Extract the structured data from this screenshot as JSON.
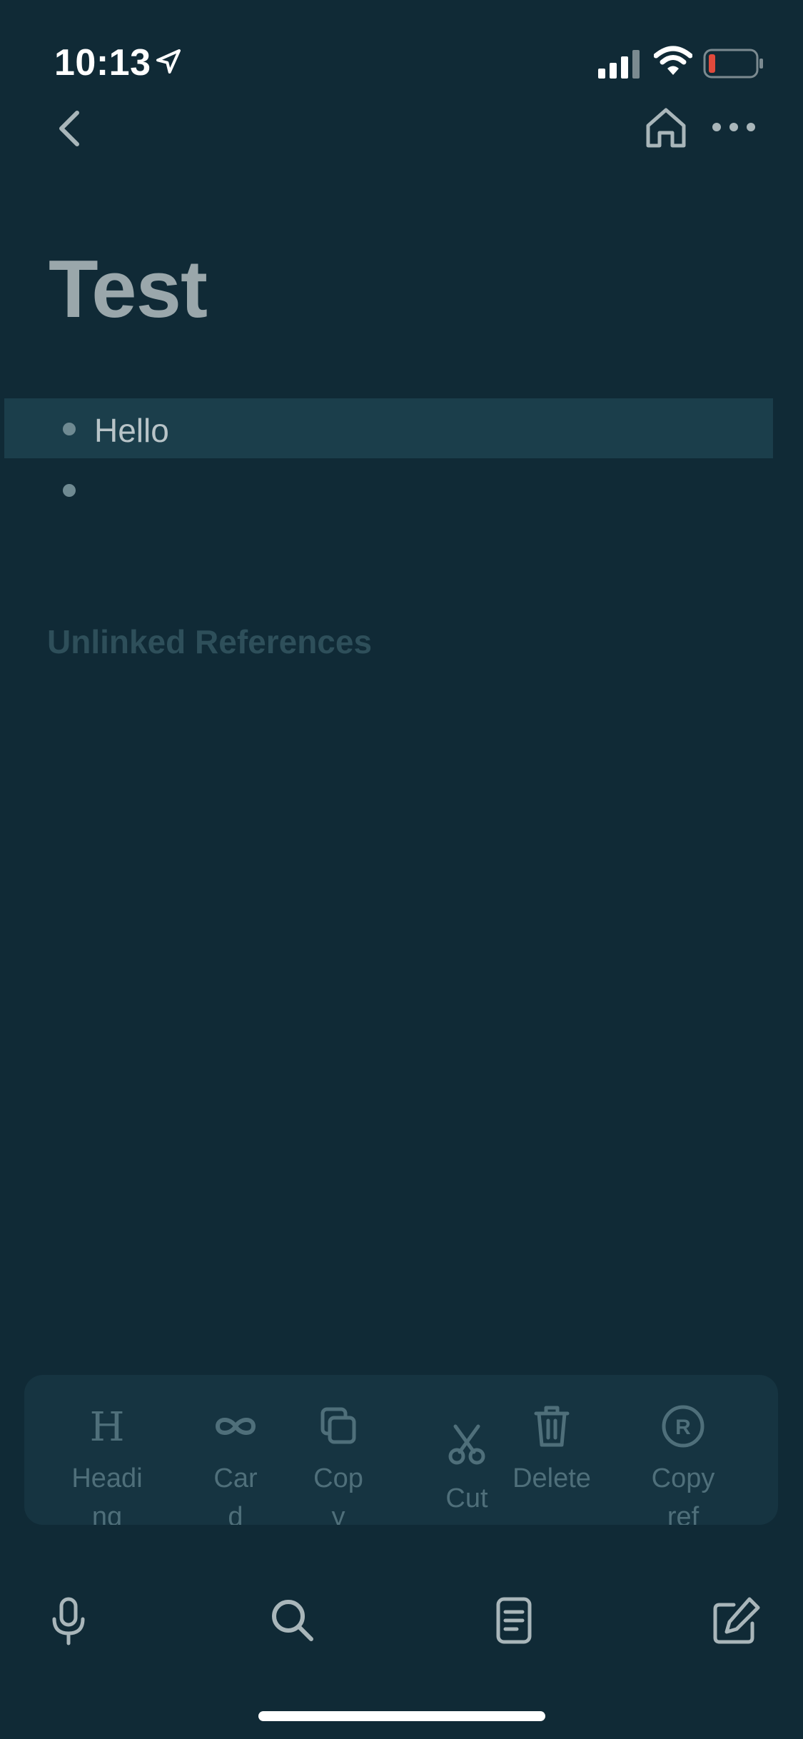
{
  "status_bar": {
    "time": "10:13",
    "battery_level": 0.1,
    "battery_color": "#e04a3c"
  },
  "nav": {
    "back_icon": "chevron-left-icon",
    "home_icon": "home-icon",
    "more_icon": "more-horizontal-icon"
  },
  "page": {
    "title": "Test",
    "blocks": [
      {
        "text": "Hello",
        "selected": true
      },
      {
        "text": "",
        "selected": false
      }
    ],
    "unlinked_references_title": "Unlinked References"
  },
  "action_bar": {
    "items": [
      {
        "label": "Heading",
        "icon": "heading-icon"
      },
      {
        "label": "Card",
        "icon": "infinity-icon"
      },
      {
        "label": "Copy",
        "icon": "copy-icon"
      },
      {
        "label": "Cut",
        "icon": "scissors-icon"
      },
      {
        "label": "Delete",
        "icon": "trash-icon"
      },
      {
        "label": "Copy ref",
        "icon": "registered-icon"
      }
    ]
  },
  "tab_bar": {
    "items": [
      {
        "icon": "microphone-icon"
      },
      {
        "icon": "search-icon"
      },
      {
        "icon": "document-icon"
      },
      {
        "icon": "edit-icon"
      }
    ]
  },
  "colors": {
    "background": "#102a36",
    "selected_row": "#1b3e4b",
    "action_bar_bg": "#163441",
    "muted_text": "#4f6f7a"
  }
}
